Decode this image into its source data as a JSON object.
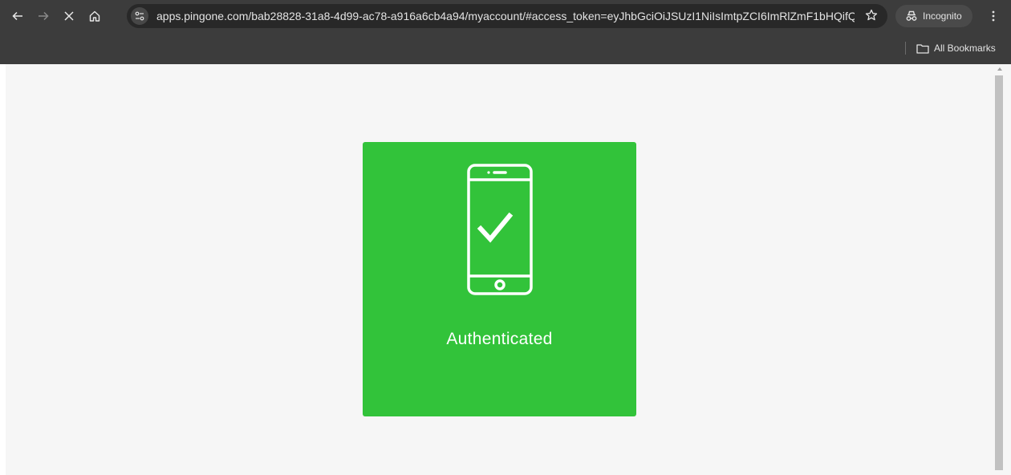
{
  "browser": {
    "url": "apps.pingone.com/bab28828-31a8-4d99-ac78-a916a6cb4a94/myaccount/#access_token=eyJhbGciOiJSUzI1NiIsImtpZCI6ImRlZmF1bHQifQ.eyJ...",
    "incognito_label": "Incognito",
    "bookmarks_label": "All Bookmarks",
    "icons": {
      "back": "arrow-left-icon",
      "forward": "arrow-right-icon",
      "stop": "close-icon",
      "home": "home-icon",
      "site_info": "tune-icon",
      "bookmark": "star-icon",
      "incognito": "incognito-icon",
      "menu": "kebab-icon",
      "folder": "folder-icon"
    }
  },
  "page": {
    "status_text": "Authenticated",
    "status_icon": "phone-check-icon",
    "card_color": "#32c33a",
    "background_color": "#f6f6f6"
  }
}
